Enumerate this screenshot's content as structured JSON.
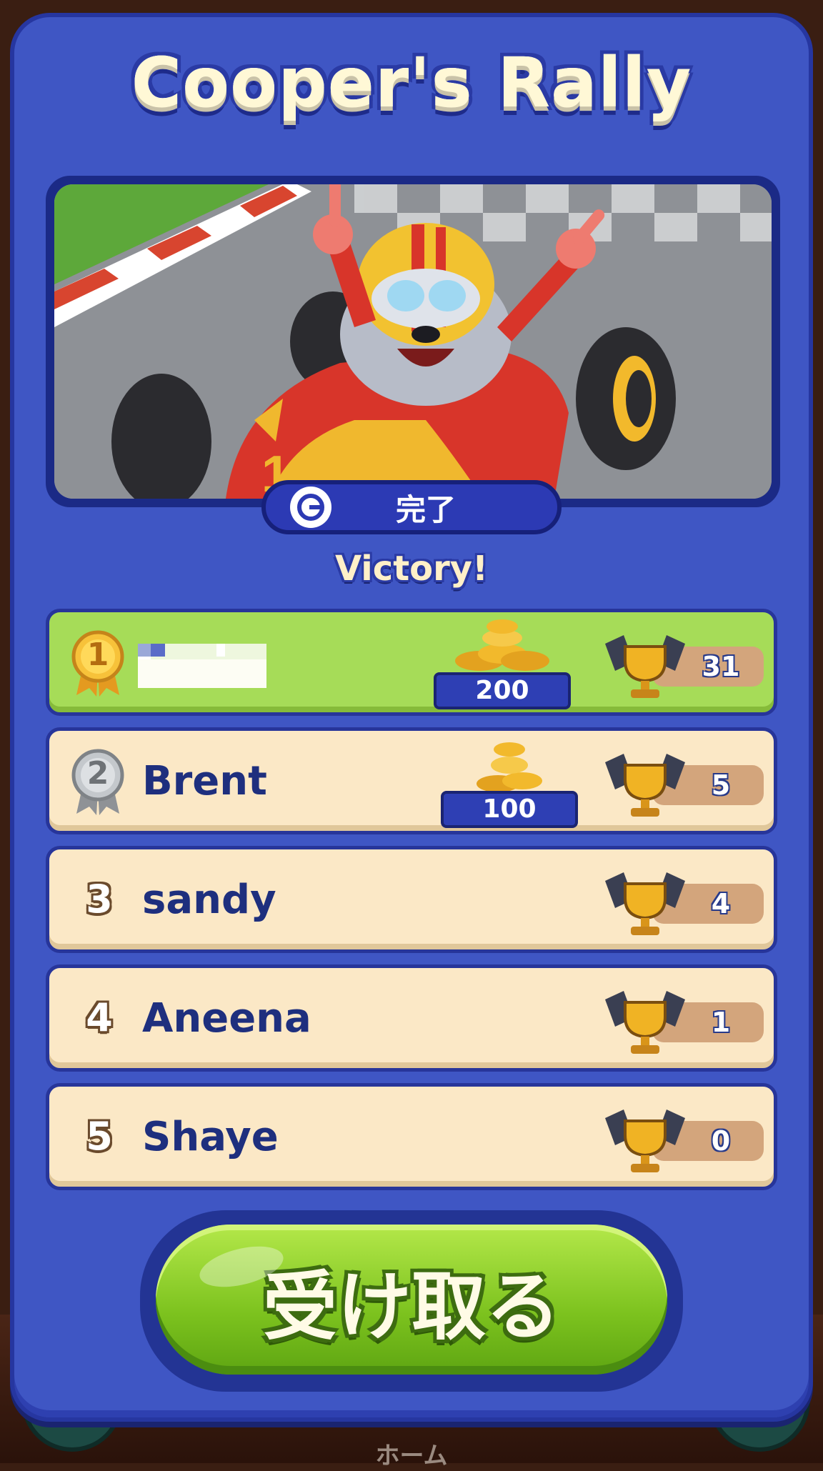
{
  "title": "Cooper's Rally",
  "status": {
    "label": "完了"
  },
  "result": "Victory!",
  "players": [
    {
      "rank": "1",
      "name": "",
      "reward": "200",
      "trophies": "31",
      "highlight": true
    },
    {
      "rank": "2",
      "name": "Brent",
      "reward": "100",
      "trophies": "5"
    },
    {
      "rank": "3",
      "name": "sandy",
      "reward": "",
      "trophies": "4"
    },
    {
      "rank": "4",
      "name": "Aneena",
      "reward": "",
      "trophies": "1"
    },
    {
      "rank": "5",
      "name": "Shaye",
      "reward": "",
      "trophies": "0"
    }
  ],
  "claim_button": {
    "label": "受け取る"
  },
  "nav": {
    "home_label": "ホーム"
  },
  "icons": {
    "status": "clock-icon",
    "reward": "coin-stack-icon",
    "trophy": "trophy-flags-icon",
    "medal_gold": "gold-medal-icon",
    "medal_silver": "silver-medal-icon",
    "nav_shop": "shop-icon",
    "nav_trophy": "trophy-icon"
  },
  "colors": {
    "panel": "#3f56c4",
    "row": "#fbe8c6",
    "row_highlight": "#a6dc58",
    "name": "#1e2f7e",
    "claim": "#7cc21e"
  }
}
